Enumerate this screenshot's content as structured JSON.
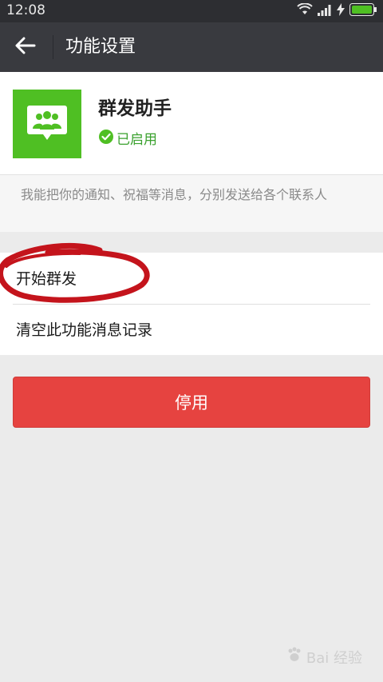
{
  "status_bar": {
    "time": "12:08",
    "icons": [
      "wifi-icon",
      "signal-icon",
      "charging-icon",
      "battery-icon"
    ]
  },
  "title_bar": {
    "title": "功能设置",
    "back_icon": "arrow-left-icon"
  },
  "feature": {
    "name": "群发助手",
    "status": "已启用",
    "icon": "group-chat-icon",
    "description": "我能把你的通知、祝福等消息，分别发送给各个联系人"
  },
  "menu": {
    "items": [
      {
        "label": "开始群发"
      },
      {
        "label": "清空此功能消息记录"
      }
    ]
  },
  "actions": {
    "stop_label": "停用"
  },
  "watermark": {
    "text": "Bai 经验"
  },
  "colors": {
    "title_bar": "#393a3f",
    "status_bar": "#2d2e32",
    "accent_green": "#4fbf23",
    "enabled_green": "#3aa12e",
    "danger_red": "#e64340",
    "annotation_red": "#c4141c"
  }
}
